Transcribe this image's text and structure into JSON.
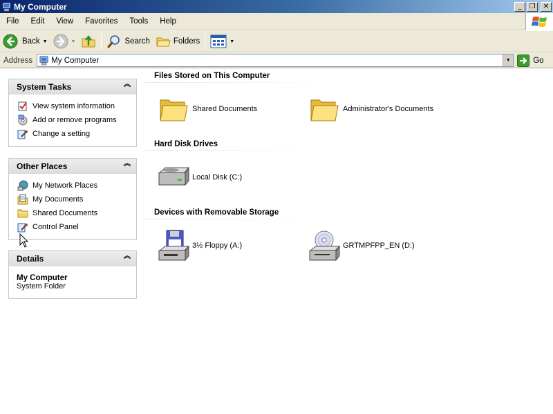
{
  "window": {
    "title": "My Computer"
  },
  "menu": {
    "items": [
      "File",
      "Edit",
      "View",
      "Favorites",
      "Tools",
      "Help"
    ]
  },
  "toolbar": {
    "back_label": "Back",
    "search_label": "Search",
    "folders_label": "Folders"
  },
  "address": {
    "label": "Address",
    "value": "My Computer",
    "go_label": "Go"
  },
  "tasks": {
    "system": {
      "title": "System Tasks",
      "items": [
        {
          "label": "View system information",
          "icon": "system-info-icon"
        },
        {
          "label": "Add or remove programs",
          "icon": "add-remove-programs-icon"
        },
        {
          "label": "Change a setting",
          "icon": "control-panel-icon"
        }
      ]
    },
    "other": {
      "title": "Other Places",
      "items": [
        {
          "label": "My Network Places",
          "icon": "network-places-icon"
        },
        {
          "label": "My Documents",
          "icon": "my-documents-icon"
        },
        {
          "label": "Shared Documents",
          "icon": "folder-icon"
        },
        {
          "label": "Control Panel",
          "icon": "control-panel-icon"
        }
      ]
    },
    "details": {
      "title": "Details",
      "name": "My Computer",
      "type": "System Folder"
    }
  },
  "content": {
    "groups": [
      {
        "title": "Files Stored on This Computer",
        "items": [
          {
            "label": "Shared Documents",
            "icon": "folder-icon"
          },
          {
            "label": "Administrator's Documents",
            "icon": "folder-icon"
          }
        ]
      },
      {
        "title": "Hard Disk Drives",
        "items": [
          {
            "label": "Local Disk (C:)",
            "icon": "hard-disk-icon"
          }
        ]
      },
      {
        "title": "Devices with Removable Storage",
        "items": [
          {
            "label": "3½ Floppy (A:)",
            "icon": "floppy-drive-icon"
          },
          {
            "label": "GRTMPFPP_EN (D:)",
            "icon": "cd-drive-icon"
          }
        ]
      }
    ]
  },
  "colors": {
    "titlebar_start": "#0a246a",
    "titlebar_end": "#a6caf0",
    "chrome": "#ece9d8"
  }
}
